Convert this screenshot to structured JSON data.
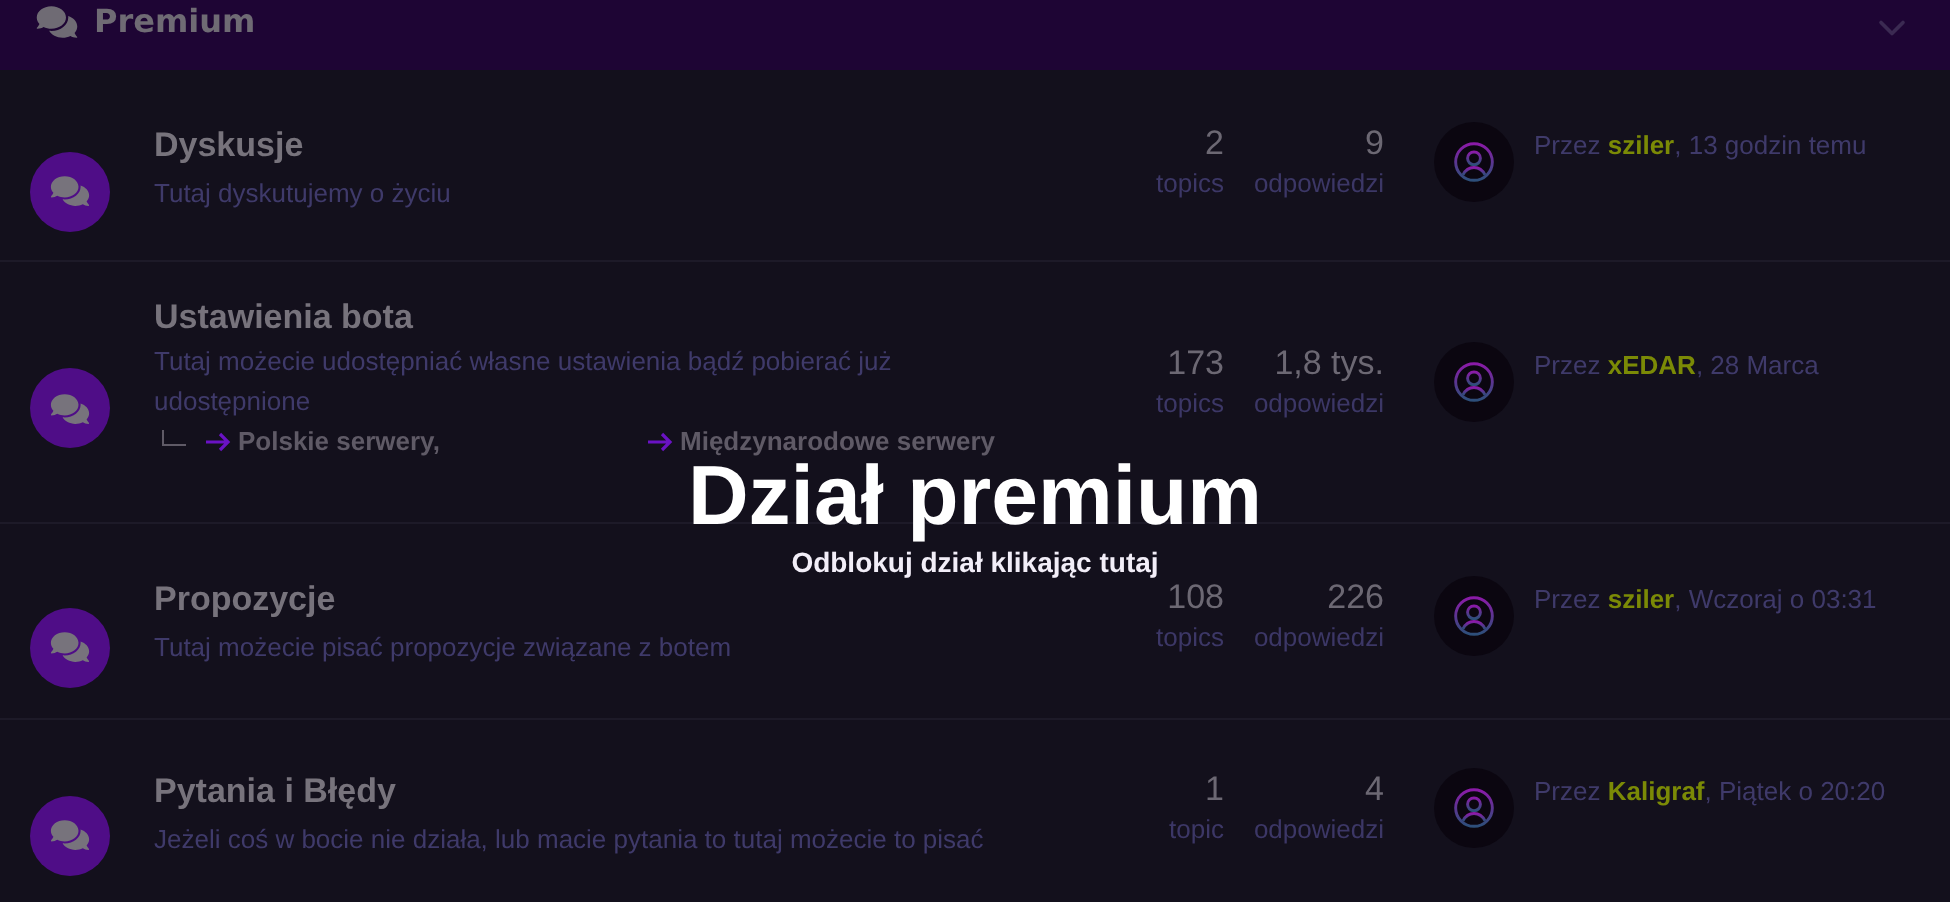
{
  "category": {
    "title": "Premium"
  },
  "forums": [
    {
      "title": "Dyskusje",
      "description": "Tutaj dyskutujemy o życiu",
      "topics_count": "2",
      "topics_label": "topics",
      "replies_count": "9",
      "replies_label": "odpowiedzi",
      "last_post": {
        "prefix": "Przez",
        "author": "sziler",
        "time": ", 13 godzin temu"
      }
    },
    {
      "title": "Ustawienia bota",
      "description": "Tutaj możecie udostępniać własne ustawienia bądź pobierać już udostępnione",
      "subforums": [
        "Polskie serwery,",
        "Międzynarodowe serwery"
      ],
      "topics_count": "173",
      "topics_label": "topics",
      "replies_count": "1,8 tys.",
      "replies_label": "odpowiedzi",
      "last_post": {
        "prefix": "Przez",
        "author": "xEDAR",
        "time": ", 28 Marca"
      }
    },
    {
      "title": "Propozycje",
      "description": "Tutaj możecie pisać propozycje związane z botem",
      "topics_count": "108",
      "topics_label": "topics",
      "replies_count": "226",
      "replies_label": "odpowiedzi",
      "last_post": {
        "prefix": "Przez",
        "author": "sziler",
        "time": ", Wczoraj o 03:31"
      }
    },
    {
      "title": "Pytania i Błędy",
      "description": "Jeżeli coś w bocie nie działa, lub macie pytania to tutaj możecie to pisać",
      "topics_count": "1",
      "topics_label": "topic",
      "replies_count": "4",
      "replies_label": "odpowiedzi",
      "last_post": {
        "prefix": "Przez",
        "author": "Kaligraf",
        "time": ", Piątek o 20:20"
      }
    }
  ],
  "overlay": {
    "title": "Dział premium",
    "link": "Odblokuj dział klikając tutaj"
  }
}
